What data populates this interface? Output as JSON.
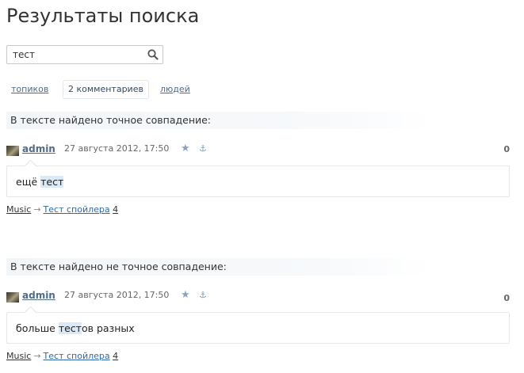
{
  "page": {
    "title": "Результаты поиска"
  },
  "search": {
    "value": "тест",
    "icon": "search-icon"
  },
  "tabs": [
    {
      "label": "топиков",
      "active": false
    },
    {
      "label": "2 комментариев",
      "active": true
    },
    {
      "label": "людей",
      "active": false
    }
  ],
  "results": [
    {
      "section_label": "В тексте найдено точное совпадение:",
      "author": "admin",
      "date": "27 августа 2012, 17:50",
      "score": "0",
      "text_before": "ещё ",
      "text_highlight": "тест",
      "text_after": "",
      "blog": "Music",
      "arrow": "→",
      "topic": "Тест спойлера",
      "comment_count": "4"
    },
    {
      "section_label": "В тексте найдено не точное совпадение:",
      "author": "admin",
      "date": "27 августа 2012, 17:50",
      "score": "0",
      "text_before": "больше ",
      "text_highlight": "тест",
      "text_after": "ов разных",
      "blog": "Music",
      "arrow": "→",
      "topic": "Тест спойлера",
      "comment_count": "4"
    }
  ],
  "icons": {
    "favourite": "star-icon",
    "anchor": "anchor-icon"
  },
  "colors": {
    "link": "#506b84",
    "highlight": "#dbe8f5",
    "section_bg": "#f3f6f9"
  }
}
